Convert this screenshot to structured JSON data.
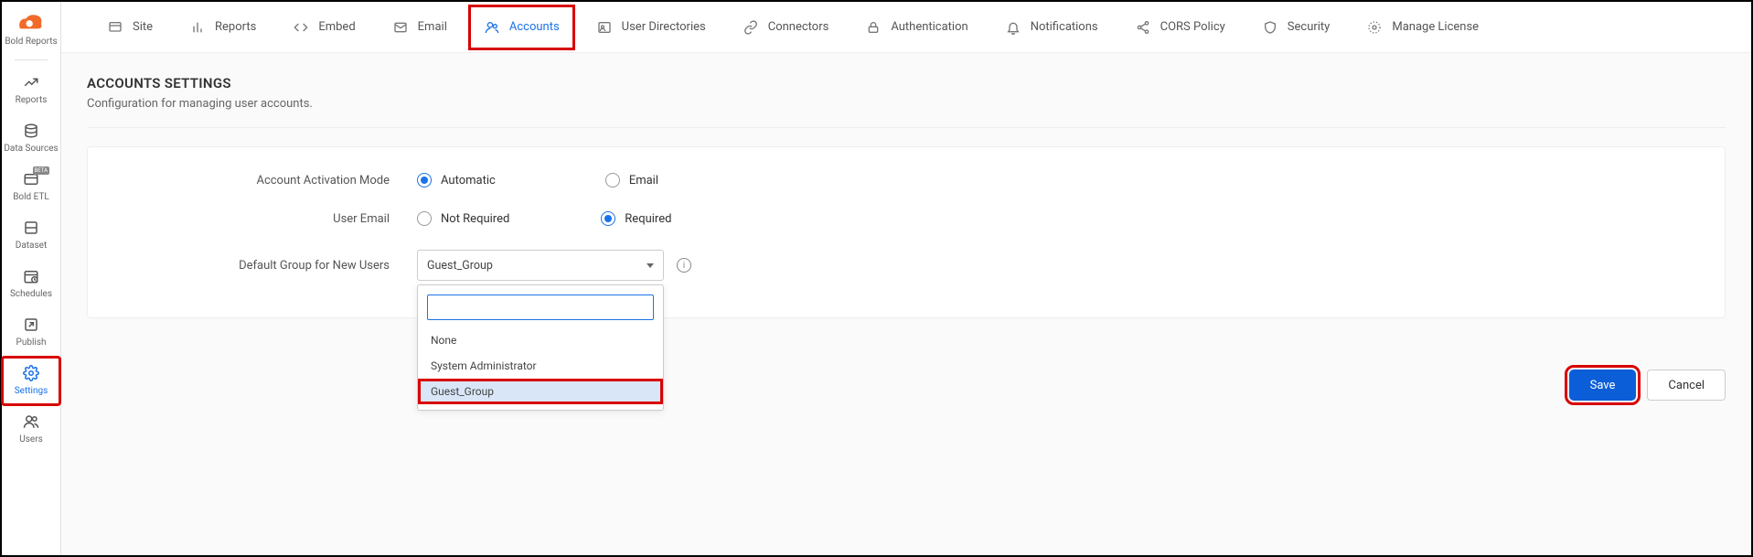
{
  "brand": {
    "name": "Bold Reports"
  },
  "sidebar": {
    "items": [
      {
        "label": "Reports"
      },
      {
        "label": "Data Sources"
      },
      {
        "label": "Bold ETL"
      },
      {
        "label": "Dataset"
      },
      {
        "label": "Schedules"
      },
      {
        "label": "Publish"
      },
      {
        "label": "Settings"
      },
      {
        "label": "Users"
      }
    ]
  },
  "topnav": {
    "tabs": [
      {
        "label": "Site"
      },
      {
        "label": "Reports"
      },
      {
        "label": "Embed"
      },
      {
        "label": "Email"
      },
      {
        "label": "Accounts"
      },
      {
        "label": "User Directories"
      },
      {
        "label": "Connectors"
      },
      {
        "label": "Authentication"
      },
      {
        "label": "Notifications"
      },
      {
        "label": "CORS Policy"
      },
      {
        "label": "Security"
      },
      {
        "label": "Manage License"
      }
    ]
  },
  "page": {
    "title": "ACCOUNTS SETTINGS",
    "subtitle": "Configuration for managing user accounts."
  },
  "form": {
    "activation_label": "Account Activation Mode",
    "activation_options": {
      "auto": "Automatic",
      "email": "Email"
    },
    "user_email_label": "User Email",
    "user_email_options": {
      "not_required": "Not Required",
      "required": "Required"
    },
    "default_group_label": "Default Group for New Users",
    "default_group_value": "Guest_Group"
  },
  "dropdown": {
    "search_value": "",
    "options": [
      "None",
      "System Administrator",
      "Guest_Group"
    ]
  },
  "buttons": {
    "save": "Save",
    "cancel": "Cancel"
  }
}
